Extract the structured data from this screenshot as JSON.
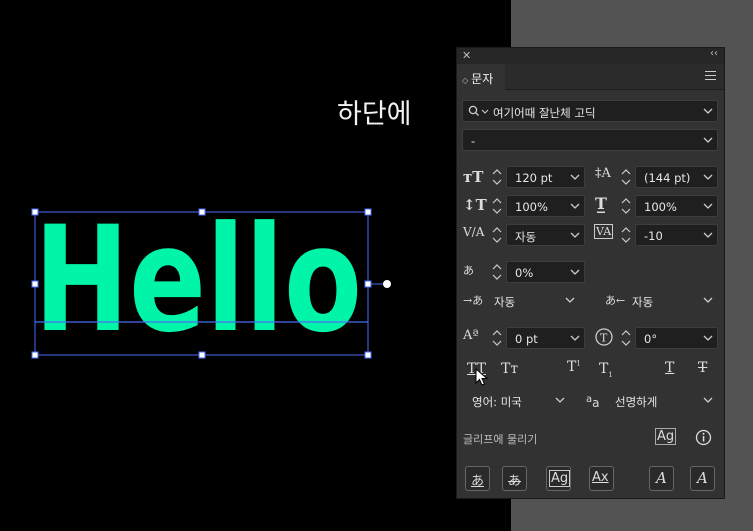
{
  "canvas": {
    "caption": "하단에",
    "artwork_text": "Hello",
    "artwork_color": "#00f5a8"
  },
  "panel": {
    "title": "문자",
    "close_glyph": "✕",
    "collapse_glyph": "‹‹",
    "font_family": "여기어때 잘난체 고딕",
    "font_style": "-",
    "font_size": "120 pt",
    "leading": "(144 pt)",
    "vertical_scale": "100%",
    "horizontal_scale": "100%",
    "kerning": "자동",
    "tracking": "-10",
    "tsume": "0%",
    "aki_left": "자동",
    "aki_right": "자동",
    "baseline_shift": "0 pt",
    "rotation": "0°",
    "language": "영어: 미국",
    "antialias_label": "a",
    "antialias": "선명하게",
    "snap_to_glyph": "글리프에 물리기",
    "style_buttons": {
      "all_caps": "TT",
      "small_caps": "Tт",
      "superscript": "T",
      "subscript": "T",
      "underline": "T",
      "strikethrough": "T"
    },
    "bottom_icons": [
      "あ",
      "あ",
      "Ag",
      "Ax",
      "A",
      "A"
    ]
  },
  "colors": {
    "accent": "#00f5a8",
    "selection": "#4a6cf7",
    "panel_bg": "#323232",
    "field_bg": "#1f1f1f",
    "pasteboard": "#535353"
  }
}
